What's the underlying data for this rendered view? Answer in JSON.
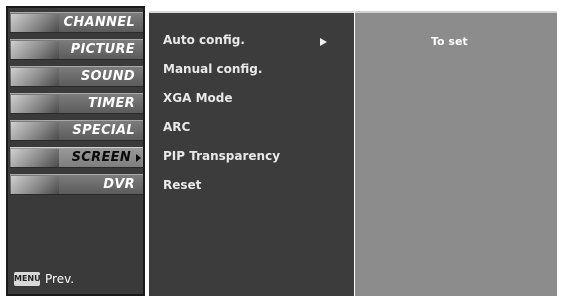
{
  "main_menu": {
    "items": [
      {
        "label": "CHANNEL",
        "icon": "channel-thumbnail"
      },
      {
        "label": "PICTURE",
        "icon": "picture-thumbnail"
      },
      {
        "label": "SOUND",
        "icon": "sound-thumbnail"
      },
      {
        "label": "TIMER",
        "icon": "timer-thumbnail"
      },
      {
        "label": "SPECIAL",
        "icon": "special-thumbnail"
      },
      {
        "label": "SCREEN",
        "icon": "screen-thumbnail",
        "selected": true
      },
      {
        "label": "DVR",
        "icon": "dvr-thumbnail"
      }
    ]
  },
  "bottom": {
    "menu_key": "MENU",
    "prev_label": "Prev."
  },
  "submenu": {
    "items": [
      {
        "label": "Auto config.",
        "has_arrow": true
      },
      {
        "label": "Manual config."
      },
      {
        "label": "XGA Mode"
      },
      {
        "label": "ARC"
      },
      {
        "label": "PIP Transparency"
      },
      {
        "label": "Reset"
      }
    ]
  },
  "detail": {
    "text": "To set"
  },
  "colors": {
    "panel_dark": "#3c3c3c",
    "panel_light": "#8c8c8c",
    "text": "#ffffff"
  }
}
